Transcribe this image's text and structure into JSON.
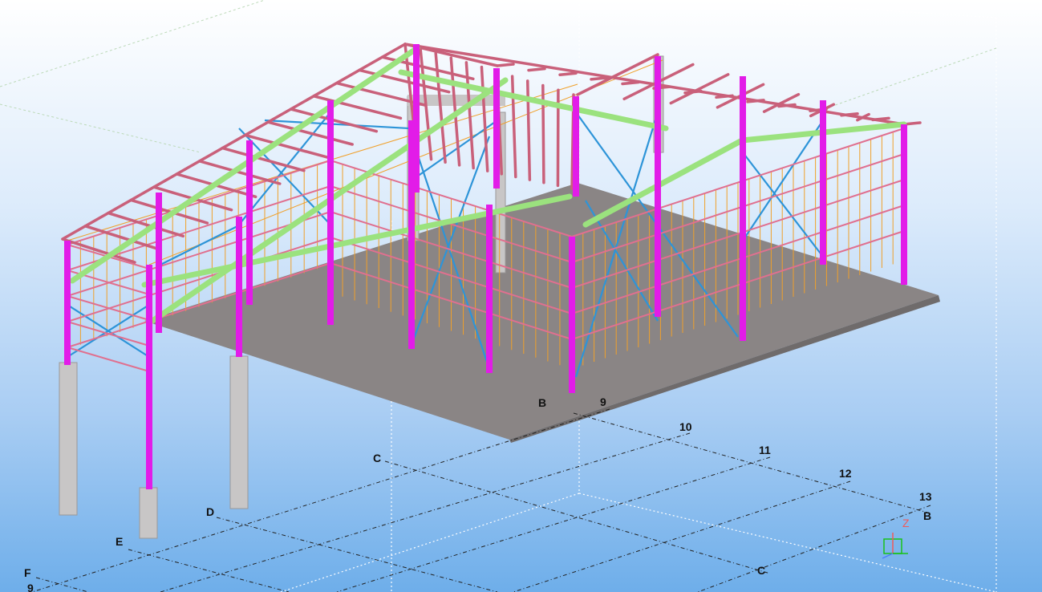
{
  "viewport": {
    "grid_labels_x": [
      "9",
      "10",
      "11",
      "12",
      "13"
    ],
    "grid_labels_y": [
      "B",
      "C",
      "D",
      "E",
      "F"
    ],
    "grid_label_bottom_left": "9",
    "grid_label_bottom_c": "C",
    "grid_label_right_b": "B",
    "axis_z_label": "Z"
  },
  "colors": {
    "background_top": "#ffffff",
    "background_bottom": "#6eaeea",
    "columns": "#e21ce8",
    "rafters": "#c9607a",
    "purlins": "#e0708f",
    "secondary_beams": "#9be27e",
    "bracing": "#2d94d8",
    "girts": "#f0a02a",
    "slab": "#8a8585",
    "concrete_pedestals": "#c8c6c6",
    "grid_lines": "#222222"
  },
  "icons": [
    "axis-triad-icon"
  ]
}
